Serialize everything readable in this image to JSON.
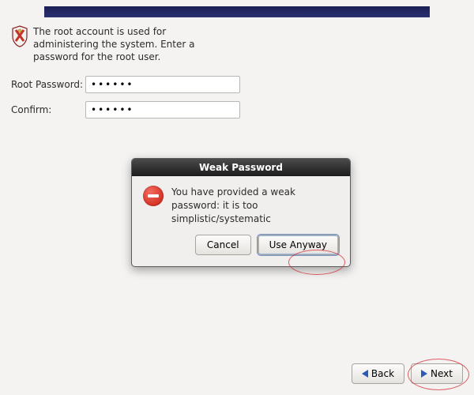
{
  "intro": {
    "text": "The root account is used for administering the system.  Enter a password for the root user."
  },
  "form": {
    "root_password_label": "Root Password:",
    "confirm_label": "Confirm:",
    "root_password_value": "••••••",
    "confirm_value": "••••••"
  },
  "dialog": {
    "title": "Weak Password",
    "message": "You have provided a weak password: it is too simplistic/systematic",
    "cancel_label": "Cancel",
    "use_anyway_label": "Use Anyway"
  },
  "nav": {
    "back_label": "Back",
    "next_label": "Next"
  }
}
